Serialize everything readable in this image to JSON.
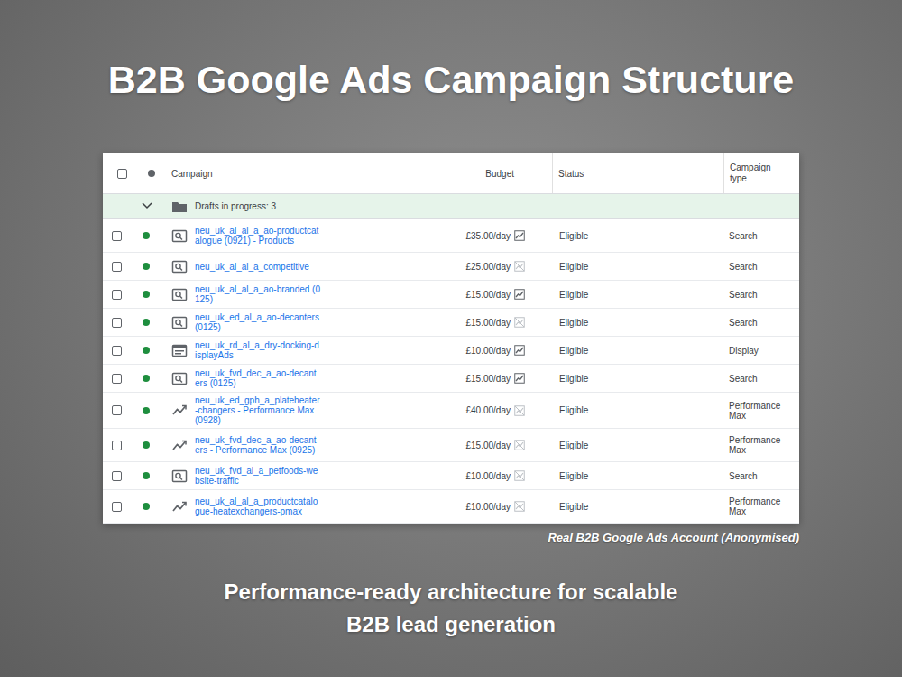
{
  "title": "B2B Google Ads Campaign Structure",
  "table": {
    "columns": [
      {
        "label": "",
        "kind": "checkbox",
        "checked": false
      },
      {
        "label": "",
        "kind": "dot"
      },
      {
        "label": "Campaign",
        "kind": "text"
      },
      {
        "label": "Budget",
        "kind": "text"
      },
      {
        "label": "Status",
        "kind": "text"
      },
      {
        "label": "Campaign type",
        "kind": "text"
      }
    ],
    "group": {
      "label": "Drafts in progress: 3",
      "expanded": true
    },
    "rows": [
      {
        "checked": false,
        "enabled": true,
        "color": "#1e8e3e",
        "kind": "search",
        "name": "neu_uk_al_al_a_ao-productcatalogue (0921) - Products",
        "budget": "£35.00/day",
        "chart_active": true,
        "status": "Eligible",
        "type": "Search"
      },
      {
        "checked": false,
        "enabled": true,
        "color": "#1e8e3e",
        "kind": "search",
        "name": "neu_uk_al_al_a_competitive",
        "budget": "£25.00/day",
        "chart_active": false,
        "status": "Eligible",
        "type": "Search"
      },
      {
        "checked": false,
        "enabled": true,
        "color": "#1e8e3e",
        "kind": "search",
        "name": "neu_uk_al_al_a_ao-branded (0125)",
        "budget": "£15.00/day",
        "chart_active": true,
        "status": "Eligible",
        "type": "Search"
      },
      {
        "checked": false,
        "enabled": true,
        "color": "#1e8e3e",
        "kind": "search",
        "name": "neu_uk_ed_al_a_ao-decanters (0125)",
        "budget": "£15.00/day",
        "chart_active": false,
        "status": "Eligible",
        "type": "Search"
      },
      {
        "checked": false,
        "enabled": true,
        "color": "#1e8e3e",
        "kind": "display",
        "name": "neu_uk_rd_al_a_dry-docking-displayAds",
        "budget": "£10.00/day",
        "chart_active": true,
        "status": "Eligible",
        "type": "Display"
      },
      {
        "checked": false,
        "enabled": true,
        "color": "#1e8e3e",
        "kind": "search",
        "name": "neu_uk_fvd_dec_a_ao-decanters (0125)",
        "budget": "£15.00/day",
        "chart_active": true,
        "status": "Eligible",
        "type": "Search"
      },
      {
        "checked": false,
        "enabled": true,
        "color": "#1e8e3e",
        "kind": "pmax",
        "name": "neu_uk_ed_gph_a_plateheater-changers - Performance Max (0928)",
        "budget": "£40.00/day",
        "chart_active": false,
        "status": "Eligible",
        "type": "Performance Max"
      },
      {
        "checked": false,
        "enabled": true,
        "color": "#1e8e3e",
        "kind": "pmax",
        "name": "neu_uk_fvd_dec_a_ao-decanters - Performance Max (0925)",
        "budget": "£15.00/day",
        "chart_active": false,
        "status": "Eligible",
        "type": "Performance Max"
      },
      {
        "checked": false,
        "enabled": true,
        "color": "#1e8e3e",
        "kind": "search",
        "name": "neu_uk_fvd_al_a_petfoods-website-traffic",
        "budget": "£10.00/day",
        "chart_active": false,
        "status": "Eligible",
        "type": "Search"
      },
      {
        "checked": false,
        "enabled": true,
        "color": "#1e8e3e",
        "kind": "pmax",
        "name": "neu_uk_al_al_a_productcatalogue-heatexchangers-pmax",
        "budget": "£10.00/day",
        "chart_active": false,
        "status": "Eligible",
        "type": "Performance Max"
      }
    ]
  },
  "caption": "Real B2B Google Ads Account (Anonymised)",
  "tagline": [
    "Performance-ready architecture for scalable",
    "B2B lead generation"
  ]
}
